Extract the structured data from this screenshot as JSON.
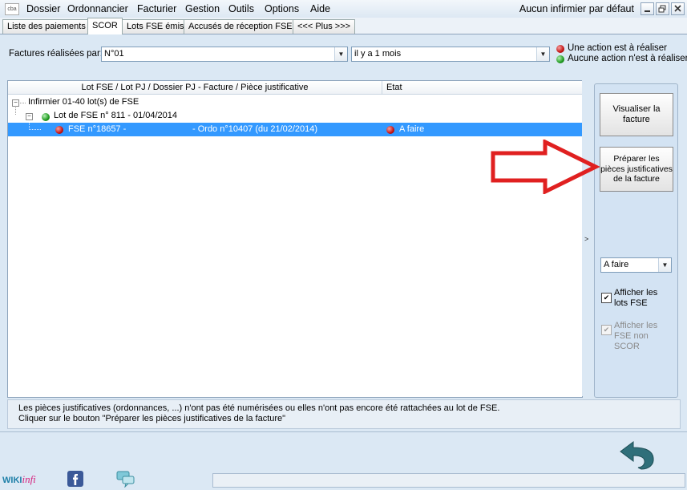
{
  "app": {
    "icon_text": "cba"
  },
  "menu": [
    {
      "label": "Dossier"
    },
    {
      "label": "Ordonnancier"
    },
    {
      "label": "Facturier"
    },
    {
      "label": "Gestion"
    },
    {
      "label": "Outils"
    },
    {
      "label": "Options"
    },
    {
      "label": "Aide"
    }
  ],
  "header": {
    "nurse_status": "Aucun infirmier par défaut"
  },
  "tabs": [
    {
      "label": "Liste des paiements",
      "active": false
    },
    {
      "label": "SCOR",
      "active": true
    },
    {
      "label": "Lots FSE émis",
      "active": false
    },
    {
      "label": "Accusés de réception FSE",
      "active": false
    },
    {
      "label": "<<< Plus >>>",
      "active": false
    }
  ],
  "filter": {
    "label": "Factures réalisées par:",
    "author_value": "N°01",
    "period_value": "il y a 1 mois"
  },
  "legend": {
    "action_needed": "Une action est à réaliser",
    "no_action": "Aucune action n'est à réaliser",
    "action_color": "#c41414",
    "ok_color": "#1f9a1f"
  },
  "tree": {
    "columns": [
      "Lot FSE / Lot PJ / Dossier PJ - Facture / Pièce justificative",
      "Etat"
    ],
    "root": "Infirmier 01-40 lot(s) de FSE",
    "lot": "Lot de FSE n° 811 - 01/04/2014",
    "fse": {
      "label": "FSE n°18657 -",
      "ordo": "- Ordo n°10407 (du 21/02/2014)",
      "state": "A faire"
    },
    "selection_color": "#3399ff"
  },
  "side": {
    "view_invoice_btn": "Visualiser la facture",
    "prepare_pj_btn": "Préparer les pièces justificatives de la facture",
    "state_filter": "A faire",
    "show_lots_label": "Afficher les lots FSE",
    "show_non_scor_label": "Afficher les FSE non SCOR"
  },
  "message": {
    "line1": "Les pièces justificatives (ordonnances, ...) n'ont pas été numérisées ou elles n'ont pas encore été rattachées au lot de FSE.",
    "line2": "Cliquer sur le bouton \"Préparer les pièces justificatives de la facture\""
  },
  "footer": {
    "wiki_a": "WIKI",
    "wiki_b": "infi"
  },
  "colors": {
    "annotation_arrow": "#e02020",
    "back_arrow": "#2f6f7a"
  }
}
